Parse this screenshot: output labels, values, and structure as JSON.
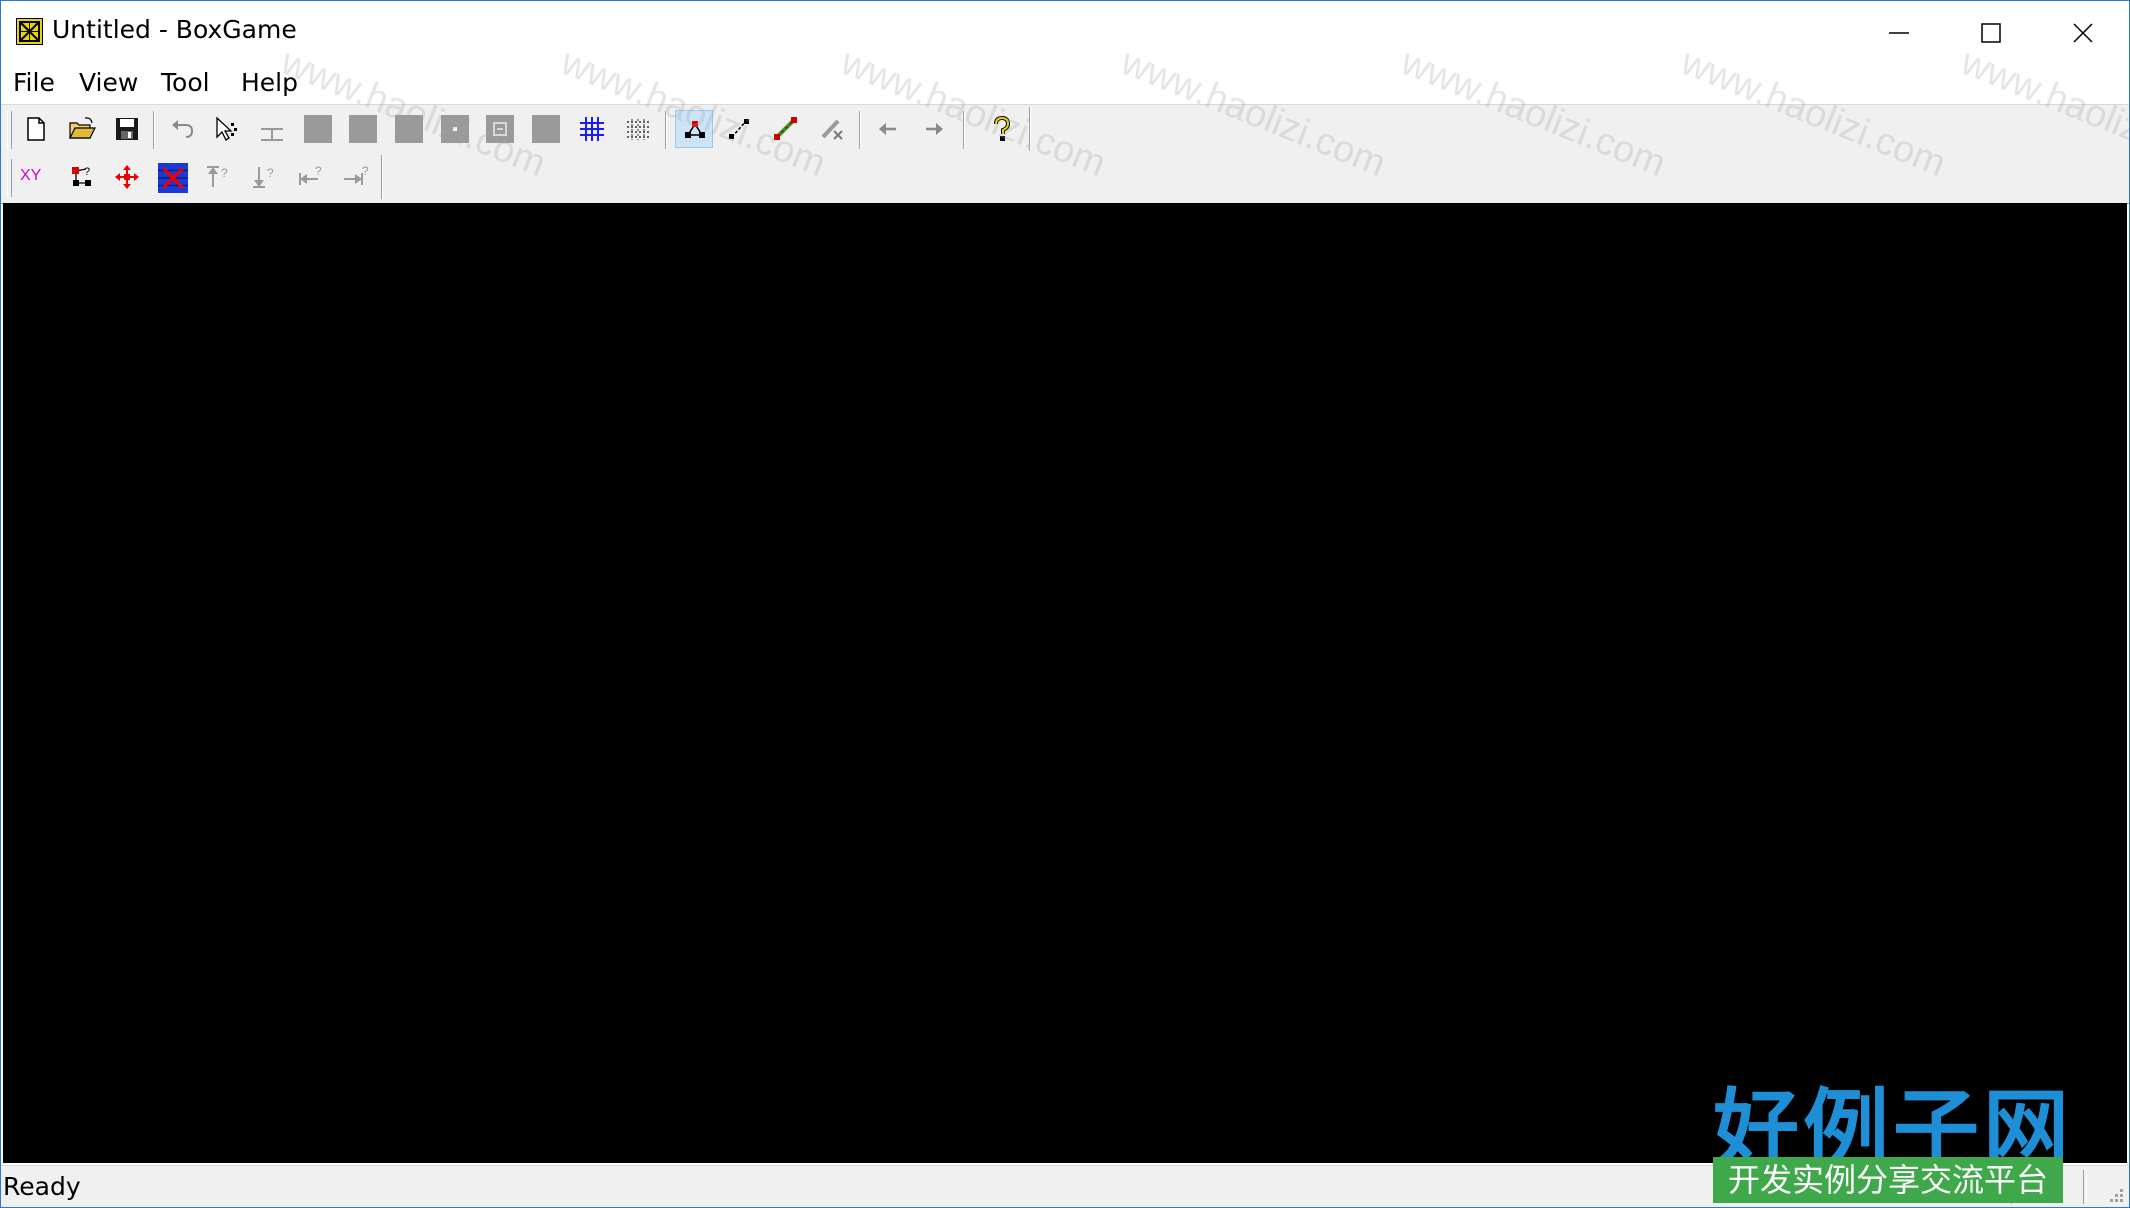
{
  "window": {
    "title": "Untitled - BoxGame",
    "app_icon": "boxgame-icon",
    "controls": [
      "minimize-icon",
      "maximize-icon",
      "close-icon"
    ]
  },
  "menu": {
    "file": "File",
    "view": "View",
    "tool": "Tool",
    "help": "Help"
  },
  "toolbar1": {
    "buttons": [
      "new-file-icon",
      "open-folder-icon",
      "save-icon",
      "undo-icon",
      "select-cursor-icon",
      "wall-icon",
      "floor-tile-icon",
      "box-tile-icon",
      "goal-tile-icon",
      "player-tile-icon",
      "box-on-goal-icon",
      "empty-tile-icon",
      "grid-icon",
      "pattern-icon",
      "link-nodes-icon",
      "path-icon",
      "route-icon",
      "erase-path-icon",
      "back-arrow-icon",
      "forward-arrow-icon",
      "help-icon"
    ],
    "pressed": "link-nodes-icon"
  },
  "toolbar2": {
    "xy_label": "XY",
    "buttons": [
      "xy-coords-icon",
      "node-tree-icon",
      "move-all-icon",
      "clear-grid-icon",
      "push-up-icon",
      "push-down-icon",
      "push-left-icon",
      "push-right-icon"
    ]
  },
  "status": {
    "text": "Ready"
  },
  "colors": {
    "canvas": "#000000",
    "accent_border": "#2b79d0",
    "toolbar_bg": "#f0f0f0"
  },
  "watermark": {
    "text": "www.haolizi.com",
    "logo": "好例子网",
    "logo_sub": "开发实例分享交流平台"
  }
}
